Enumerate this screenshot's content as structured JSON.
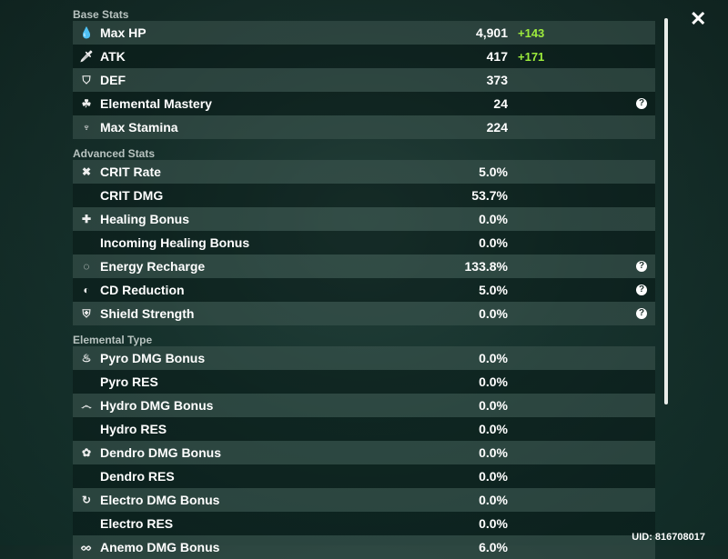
{
  "base_stats": {
    "title": "Base Stats",
    "rows": [
      {
        "icon": "hp-drop-icon",
        "glyph": "💧",
        "label": "Max HP",
        "value": "4,901",
        "bonus": "+143"
      },
      {
        "icon": "sword-icon",
        "glyph": "🗡",
        "label": "ATK",
        "value": "417",
        "bonus": "+171"
      },
      {
        "icon": "shield-icon",
        "glyph": "⛉",
        "label": "DEF",
        "value": "373"
      },
      {
        "icon": "elemental-mastery-icon",
        "glyph": "☘",
        "label": "Elemental Mastery",
        "value": "24",
        "help": "?"
      },
      {
        "icon": "stamina-icon",
        "glyph": "♆",
        "label": "Max Stamina",
        "value": "224"
      }
    ]
  },
  "advanced_stats": {
    "title": "Advanced Stats",
    "rows": [
      {
        "icon": "crit-icon",
        "glyph": "✖",
        "label": "CRIT Rate",
        "value": "5.0%"
      },
      {
        "label": "CRIT DMG",
        "value": "53.7%"
      },
      {
        "icon": "healing-cross-icon",
        "glyph": "✚",
        "label": "Healing Bonus",
        "value": "0.0%"
      },
      {
        "label": "Incoming Healing Bonus",
        "value": "0.0%"
      },
      {
        "icon": "energy-recharge-icon",
        "glyph": "◌",
        "label": "Energy Recharge",
        "value": "133.8%",
        "help": "?"
      },
      {
        "icon": "cd-reduction-icon",
        "glyph": "◐",
        "label": "CD Reduction",
        "value": "5.0%",
        "help": "?"
      },
      {
        "icon": "shield-strength-icon",
        "glyph": "⛨",
        "label": "Shield Strength",
        "value": "0.0%",
        "help": "?"
      }
    ]
  },
  "elemental_type": {
    "title": "Elemental Type",
    "rows": [
      {
        "icon": "pyro-icon",
        "glyph": "♨",
        "label": "Pyro DMG Bonus",
        "value": "0.0%"
      },
      {
        "label": "Pyro RES",
        "value": "0.0%"
      },
      {
        "icon": "hydro-icon",
        "glyph": "෴",
        "label": "Hydro DMG Bonus",
        "value": "0.0%"
      },
      {
        "label": "Hydro RES",
        "value": "0.0%"
      },
      {
        "icon": "dendro-icon",
        "glyph": "✿",
        "label": "Dendro DMG Bonus",
        "value": "0.0%"
      },
      {
        "label": "Dendro RES",
        "value": "0.0%"
      },
      {
        "icon": "electro-icon",
        "glyph": "↻",
        "label": "Electro DMG Bonus",
        "value": "0.0%"
      },
      {
        "label": "Electro RES",
        "value": "0.0%"
      },
      {
        "icon": "anemo-icon",
        "glyph": "ᨖ",
        "label": "Anemo DMG Bonus",
        "value": "6.0%"
      }
    ]
  },
  "close_glyph": "✕",
  "uid": "UID: 816708017",
  "colors": {
    "bonus": "#9dec3c"
  }
}
